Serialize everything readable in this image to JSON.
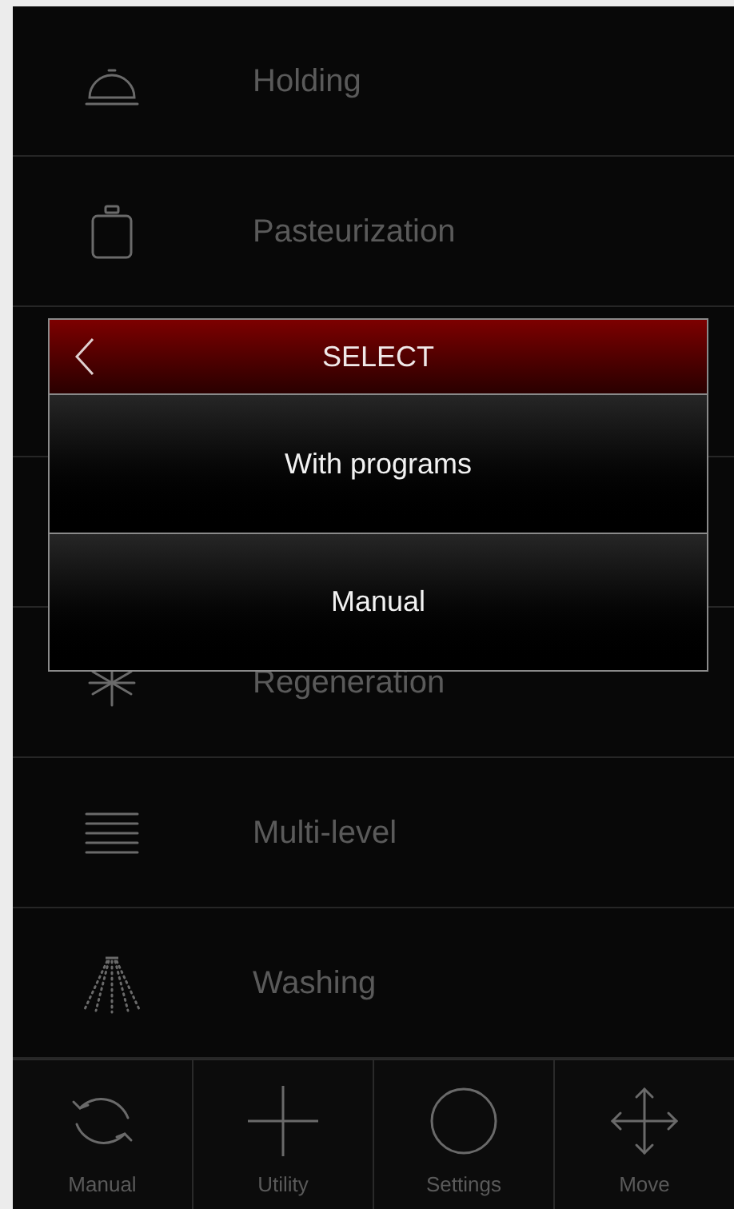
{
  "menu_items": [
    {
      "label": "Holding",
      "kind": "cloche"
    },
    {
      "label": "Pasteurization",
      "kind": "jar"
    },
    {
      "label": "Regeneration",
      "kind": "snowflake"
    },
    {
      "label": "Multi-level",
      "kind": "lines"
    },
    {
      "label": "Washing",
      "kind": "shower"
    }
  ],
  "dialog": {
    "title": "SELECT",
    "options": [
      "With programs",
      "Manual"
    ]
  },
  "bottom_bar": [
    {
      "label": "Manual",
      "kind": "cycle"
    },
    {
      "label": "Utility",
      "kind": "plus"
    },
    {
      "label": "Settings",
      "kind": "circle"
    },
    {
      "label": "Move",
      "kind": "move"
    }
  ]
}
